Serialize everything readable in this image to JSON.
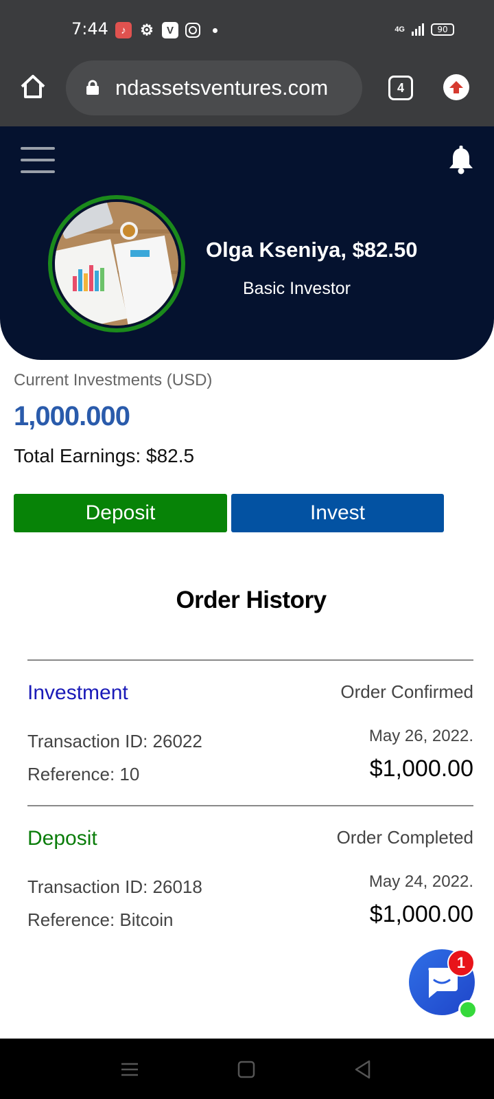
{
  "status_bar": {
    "time": "7:44",
    "network": "4G",
    "battery": "90"
  },
  "browser": {
    "url": "ndassetsventures.com",
    "tab_count": "4"
  },
  "profile": {
    "name": "Olga Kseniya, $82.50",
    "tier": "Basic Investor"
  },
  "summary": {
    "investments_label": "Current Investments (USD)",
    "investments_amount": "1,000.000",
    "earnings": "Total Earnings: $82.5"
  },
  "actions": {
    "deposit_label": "Deposit",
    "invest_label": "Invest"
  },
  "order_history": {
    "title": "Order History",
    "orders": [
      {
        "type": "Investment",
        "type_color": "#1a1ab8",
        "status": "Order Confirmed",
        "transaction_id": "Transaction ID: 26022",
        "reference": "Reference: 10",
        "date": "May 26, 2022.",
        "amount": "$1,000.00"
      },
      {
        "type": "Deposit",
        "type_color": "#0b7d0b",
        "status": "Order Completed",
        "transaction_id": "Transaction ID: 26018",
        "reference": "Reference: Bitcoin",
        "date": "May 24, 2022.",
        "amount": "$1,000.00"
      }
    ]
  },
  "chat": {
    "badge_count": "1"
  },
  "colors": {
    "header_bg": "#05122f",
    "deposit_green": "#078307",
    "invest_blue": "#0352a2",
    "amount_blue": "#2a5bab"
  }
}
